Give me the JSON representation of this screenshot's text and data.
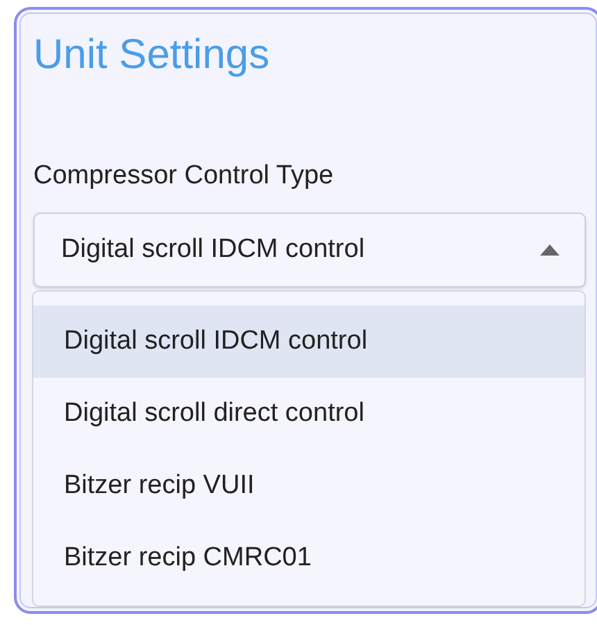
{
  "card": {
    "title": "Unit Settings"
  },
  "field": {
    "label": "Compressor Control Type",
    "value": "Digital scroll IDCM control",
    "expanded": true
  },
  "options": [
    {
      "label": "Digital scroll IDCM control",
      "selected": true
    },
    {
      "label": "Digital scroll direct control",
      "selected": false
    },
    {
      "label": "Bitzer recip VUII",
      "selected": false
    },
    {
      "label": "Bitzer recip CMRC01",
      "selected": false
    }
  ]
}
